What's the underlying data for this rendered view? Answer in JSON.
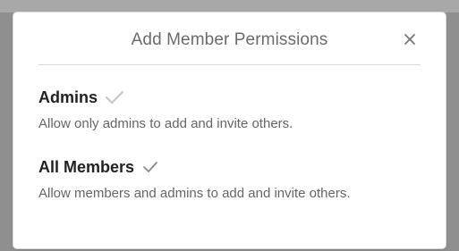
{
  "dialog": {
    "title": "Add Member Permissions",
    "close_label": "×"
  },
  "options": [
    {
      "title": "Admins",
      "description": "Allow only admins to add and invite others.",
      "icon": "check-icon",
      "check_color": "#c4c4c4"
    },
    {
      "title": "All Members",
      "description": "Allow members and admins to add and invite others.",
      "icon": "check-icon",
      "check_color": "#8a8a8a"
    }
  ]
}
